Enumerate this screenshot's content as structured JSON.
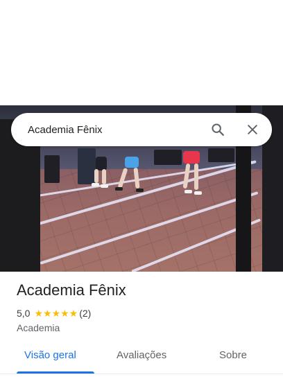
{
  "search": {
    "query": "Academia Fênix",
    "search_icon": "search-icon",
    "close_icon": "close-icon"
  },
  "place": {
    "name": "Academia Fênix",
    "rating": "5,0",
    "stars": "★★★★★",
    "review_count": "(2)",
    "category": "Academia"
  },
  "tabs": [
    {
      "label": "Visão geral",
      "active": true
    },
    {
      "label": "Avaliações",
      "active": false
    },
    {
      "label": "Sobre",
      "active": false
    }
  ],
  "colors": {
    "accent": "#1a73e8",
    "star": "#fbbc04"
  }
}
